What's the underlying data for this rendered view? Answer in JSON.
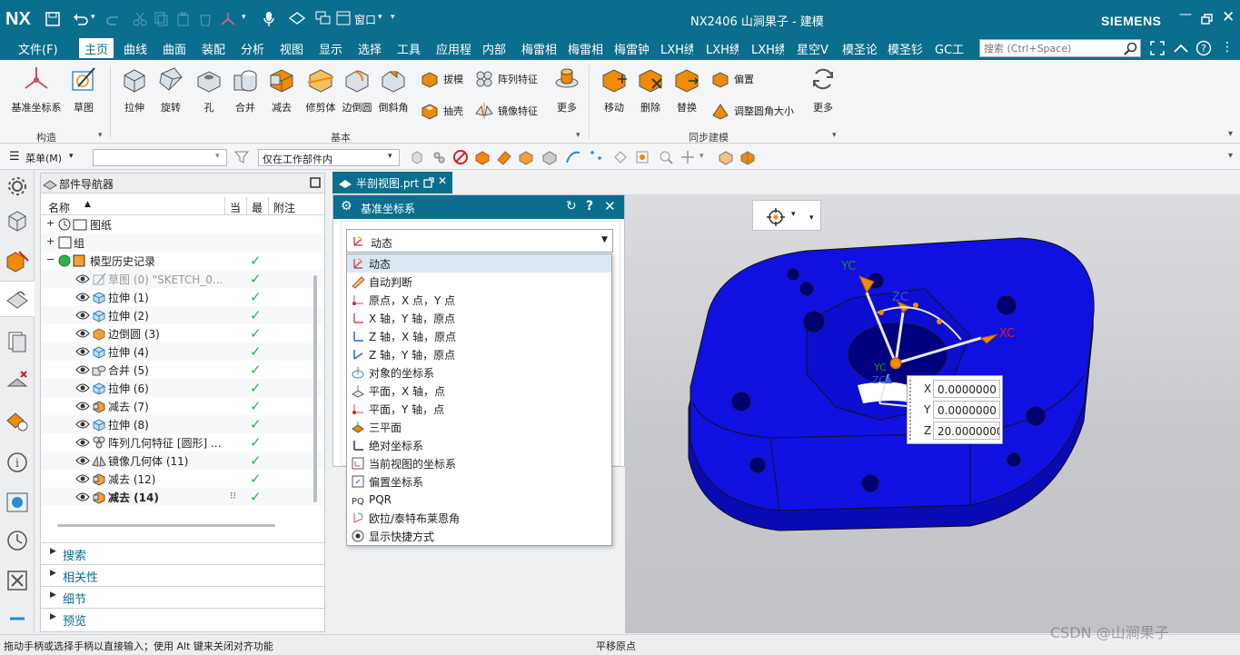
{
  "app": {
    "logo": "NX",
    "title": "NX2406 山涧果子 - 建模",
    "brand": "SIEMENS",
    "window_label": "窗口"
  },
  "menus": [
    "文件(F)",
    "主页",
    "曲线",
    "曲面",
    "装配",
    "分析",
    "视图",
    "显示",
    "选择",
    "工具",
    "应用程",
    "内部",
    "梅雷相",
    "梅雷相",
    "梅雷钟",
    "LXH绣",
    "LXH绣",
    "LXH绣",
    "星空V",
    "模圣论",
    "模圣钐",
    "GC工"
  ],
  "search": {
    "placeholder": "搜索 (Ctrl+Space)"
  },
  "ribbon": {
    "big": [
      "基准坐标系",
      "草图",
      "拉伸",
      "旋转",
      "孔",
      "合并",
      "减去",
      "修剪体",
      "边倒圆",
      "倒斜角",
      "更多",
      "移动",
      "删除",
      "替换",
      "更多"
    ],
    "small": [
      "拔模",
      "阵列特征",
      "抽壳",
      "镜像特征",
      "偏置",
      "调整圆角大小"
    ],
    "groups": [
      "构造",
      "基本",
      "同步建模"
    ]
  },
  "toolbar2": {
    "menu": "菜单(M)",
    "filter": "仅在工作部件内"
  },
  "navigator": {
    "title": "部件导航器",
    "columns": [
      "名称",
      "当",
      "最",
      "附注"
    ],
    "rows": [
      {
        "label": "图纸",
        "check": false
      },
      {
        "label": "组",
        "check": false
      },
      {
        "label": "模型历史记录",
        "check": true
      },
      {
        "label": "草图 (0) \"SKETCH_0...",
        "check": true
      },
      {
        "label": "拉伸 (1)",
        "check": true
      },
      {
        "label": "拉伸 (2)",
        "check": true
      },
      {
        "label": "边倒圆 (3)",
        "check": true
      },
      {
        "label": "拉伸 (4)",
        "check": true
      },
      {
        "label": "合并 (5)",
        "check": true
      },
      {
        "label": "拉伸 (6)",
        "check": true
      },
      {
        "label": "减去 (7)",
        "check": true
      },
      {
        "label": "拉伸 (8)",
        "check": true
      },
      {
        "label": "阵列几何特征 [圆形] ...",
        "check": true
      },
      {
        "label": "镜像几何体 (11)",
        "check": true
      },
      {
        "label": "减去 (12)",
        "check": true
      },
      {
        "label": "减去 (14)",
        "check": true
      }
    ],
    "sections": [
      "搜索",
      "相关性",
      "细节",
      "预览"
    ]
  },
  "tab": {
    "label": "半剖视图.prt"
  },
  "dialog": {
    "title": "基准坐标系",
    "selected": "动态",
    "options": [
      "动态",
      "自动判断",
      "原点，X 点，Y 点",
      "X 轴，Y 轴，原点",
      "Z 轴，X 轴，原点",
      "Z 轴，Y 轴，原点",
      "对象的坐标系",
      "平面，X 轴，点",
      "平面，Y 轴，点",
      "三平面",
      "绝对坐标系",
      "当前视图的坐标系",
      "偏置坐标系",
      "PQR",
      "欧拉/泰特布莱恩角",
      "显示快捷方式"
    ]
  },
  "viewport": {
    "axes": {
      "xc": "XC",
      "yc": "YC",
      "zc": "ZC"
    },
    "coords": [
      {
        "label": "X",
        "value": "0.0000000"
      },
      {
        "label": "Y",
        "value": "0.0000000"
      },
      {
        "label": "Z",
        "value": "20.0000000"
      }
    ]
  },
  "status": {
    "left": "拖动手柄或选择手柄以直接输入；使用 Alt 键来关闭对齐功能",
    "center": "平移原点",
    "watermark": "CSDN @山涧果子"
  },
  "colors": {
    "titlebar": "#0b6e8e",
    "part": "#1010e0",
    "accent": "#f08a00",
    "check": "#2db34a"
  }
}
